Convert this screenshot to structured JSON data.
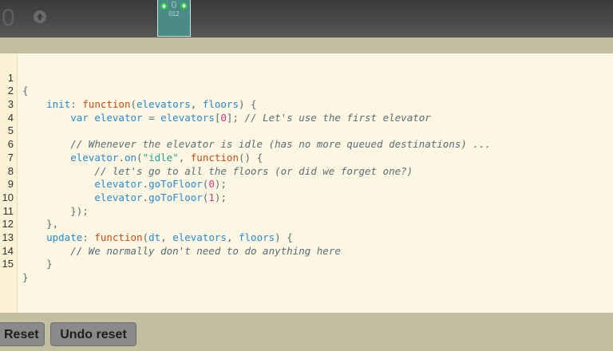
{
  "simulation": {
    "floor_number": "0",
    "elevator": {
      "people_count": "0",
      "label": "012"
    }
  },
  "editor": {
    "lines": [
      {
        "n": "1"
      },
      {
        "n": "2"
      },
      {
        "n": "3"
      },
      {
        "n": "4"
      },
      {
        "n": "5"
      },
      {
        "n": "6"
      },
      {
        "n": "7"
      },
      {
        "n": "8"
      },
      {
        "n": "9"
      },
      {
        "n": "10"
      },
      {
        "n": "11"
      },
      {
        "n": "12"
      },
      {
        "n": "13"
      },
      {
        "n": "14"
      },
      {
        "n": "15"
      }
    ],
    "tokens": {
      "l1_open": "{",
      "l2_init": "init",
      "l2_colon": ": ",
      "l2_function": "function",
      "l2_p1": "(",
      "l2_elevators": "elevators",
      "l2_comma": ", ",
      "l2_floors": "floors",
      "l2_p2": ") {",
      "l3_var": "var",
      "l3_sp": " ",
      "l3_elevator": "elevator",
      "l3_eq": " = ",
      "l3_elevators": "elevators",
      "l3_b1": "[",
      "l3_zero": "0",
      "l3_b2": "]; ",
      "l3_comment": "// Let's use the first elevator",
      "l5_comment": "// Whenever the elevator is idle (has no more queued destinations) ...",
      "l6_elevator": "elevator",
      "l6_dot": ".",
      "l6_on": "on",
      "l6_p1": "(",
      "l6_str": "\"idle\"",
      "l6_comma": ", ",
      "l6_function": "function",
      "l6_p2": "() {",
      "l7_comment": "// let's go to all the floors (or did we forget one?)",
      "l8_elevator": "elevator",
      "l8_dot": ".",
      "l8_method": "goToFloor",
      "l8_p1": "(",
      "l8_num": "0",
      "l8_p2": ");",
      "l9_elevator": "elevator",
      "l9_dot": ".",
      "l9_method": "goToFloor",
      "l9_p1": "(",
      "l9_num": "1",
      "l9_p2": ");",
      "l10_close": "});",
      "l11_close": "},",
      "l12_update": "update",
      "l12_colon": ": ",
      "l12_function": "function",
      "l12_p1": "(",
      "l12_dt": "dt",
      "l12_c1": ", ",
      "l12_elevators": "elevators",
      "l12_c2": ", ",
      "l12_floors": "floors",
      "l12_p2": ") {",
      "l13_comment": "// We normally don't need to do anything here",
      "l14_close": "}",
      "l15_close": "}"
    }
  },
  "buttons": {
    "reset": "Reset",
    "undo_reset": "Undo reset"
  },
  "colors": {
    "keyword": "#cb4b16",
    "property": "#268bd2",
    "number": "#d33682",
    "string": "#2aa198",
    "comment": "#586e75",
    "editor_bg": "#fdf6e3",
    "elevator": "#4a8a87"
  }
}
